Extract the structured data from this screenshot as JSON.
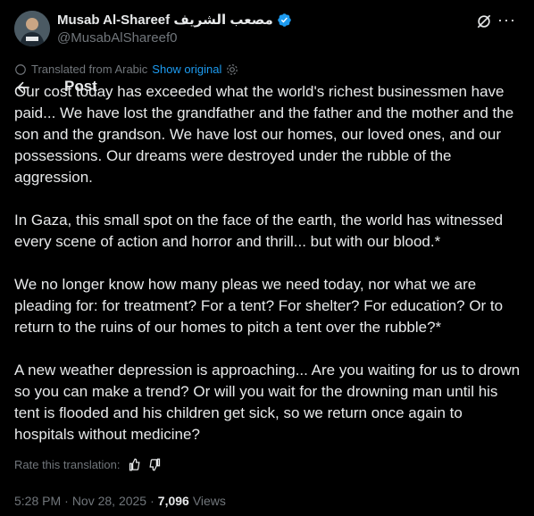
{
  "author": {
    "display_name": "Musab Al-Shareef مصعب الشريف",
    "handle": "@MusabAlShareef0",
    "verified_color": "#1d9bf0"
  },
  "translation": {
    "label": "Translated from Arabic",
    "show_original": "Show original"
  },
  "header": {
    "title": "Post"
  },
  "post": {
    "paragraphs": [
      "Our cost today has exceeded what the world's richest businessmen have paid... We have lost the grandfather and the father and the mother and the son and the grandson. We have lost our homes, our loved ones, and our possessions. Our dreams were destroyed under the rubble of the aggression.",
      "In Gaza, this small spot on the face of the earth, the world has witnessed every scene of action and horror and thrill... but with our blood.*",
      "We no longer know how many pleas we need today, nor what we are pleading for: for treatment? For a tent? For shelter? For education? Or to return to the ruins of our homes to pitch a tent over the rubble?*",
      "A new weather depression is approaching... Are you waiting for us to drown so you can make a trend? Or will you wait for the drowning man until his tent is flooded and his children get sick, so we return once again to hospitals without medicine?"
    ]
  },
  "rating": {
    "label": "Rate this translation:"
  },
  "meta": {
    "time": "5:28 PM",
    "separator1": "·",
    "date": "Nov 28, 2025",
    "separator2": "·",
    "views_count": "7,096",
    "views_label": "Views"
  },
  "icons": {
    "back": "arrow-left-icon",
    "grok": "grok-icon",
    "more": "more-icon",
    "gear": "gear-icon",
    "thumbs_up": "thumbs-up-icon",
    "thumbs_down": "thumbs-down-icon",
    "verified": "verified-badge-icon"
  }
}
